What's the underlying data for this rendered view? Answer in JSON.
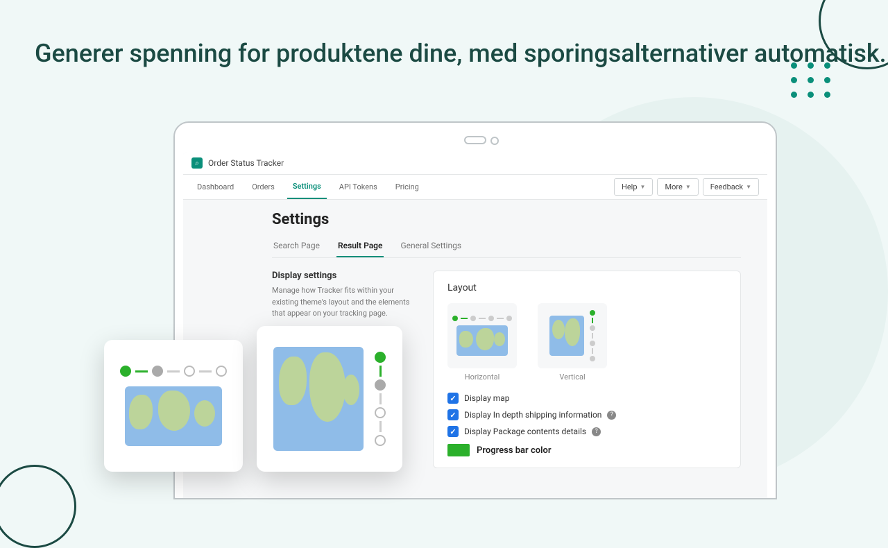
{
  "headline": "Generer spenning for produktene dine, med sporingsalternativer automatisk.",
  "app": {
    "title": "Order Status Tracker",
    "nav": [
      "Dashboard",
      "Orders",
      "Settings",
      "API Tokens",
      "Pricing"
    ],
    "nav_active": 2,
    "buttons": {
      "help": "Help",
      "more": "More",
      "feedback": "Feedback"
    }
  },
  "page": {
    "title": "Settings",
    "subtabs": [
      "Search Page",
      "Result Page",
      "General Settings"
    ],
    "subtab_active": 1,
    "section_title": "Display settings",
    "section_desc": "Manage how Tracker fits within your existing theme's layout and the elements that appear on your tracking page.",
    "panel_title": "Layout",
    "layout_options": [
      "Horizontal",
      "Vertical"
    ],
    "checks": [
      "Display map",
      "Display In depth shipping information",
      "Display Package contents details"
    ],
    "swatch_label": "Progress bar color"
  }
}
